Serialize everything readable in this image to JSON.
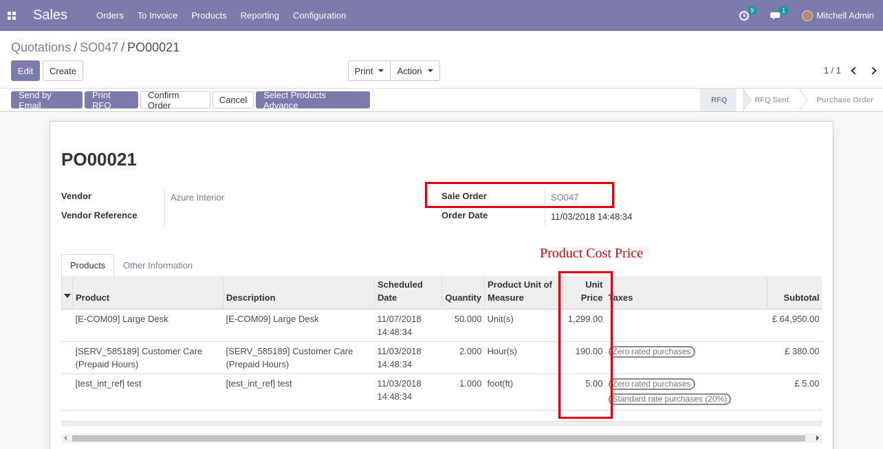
{
  "nav": {
    "brand": "Sales",
    "menu": [
      "Orders",
      "To Invoice",
      "Products",
      "Reporting",
      "Configuration"
    ],
    "activity_badge": "9",
    "messages_badge": "1",
    "user_name": "Mitchell Admin",
    "accent_color": "#7c7bad"
  },
  "breadcrumb": {
    "item1": "Quotations",
    "item2": "SO047",
    "current": "PO00021",
    "sep": "/"
  },
  "controls": {
    "edit": "Edit",
    "create": "Create",
    "print": "Print",
    "action": "Action",
    "pager": "1 / 1"
  },
  "actions": {
    "send_email": "Send by Email",
    "print_rfq": "Print RFQ",
    "confirm": "Confirm Order",
    "cancel": "Cancel",
    "select_products": "Select Products Advance"
  },
  "statusbar": {
    "stages": [
      "RFQ",
      "RFQ Sent",
      "Purchase Order"
    ],
    "active": "RFQ"
  },
  "form": {
    "title": "PO00021",
    "vendor_label": "Vendor",
    "vendor_value": "Azure Interior",
    "vendor_ref_label": "Vendor Reference",
    "sale_order_label": "Sale Order",
    "sale_order_value": "SO047",
    "order_date_label": "Order Date",
    "order_date_value": "11/03/2018 14:48:34"
  },
  "annotation": {
    "text": "Product Cost Price",
    "color": "#e0000f"
  },
  "tabs": [
    "Products",
    "Other Information"
  ],
  "table": {
    "headers": {
      "product": "Product",
      "description": "Description",
      "scheduled_date": "Scheduled Date",
      "quantity": "Quantity",
      "uom": "Product Unit of Measure",
      "unit_price": "Unit Price",
      "taxes": "Taxes",
      "subtotal": "Subtotal"
    },
    "rows": [
      {
        "product": "[E-COM09] Large Desk",
        "description": "[E-COM09] Large Desk",
        "scheduled_date": "11/07/2018 14:48:34",
        "quantity": "50.000",
        "uom": "Unit(s)",
        "unit_price": "1,299.00",
        "taxes": [],
        "subtotal": "£ 64,950.00"
      },
      {
        "product": "[SERV_585189] Customer Care (Prepaid Hours)",
        "description": "[SERV_585189] Customer Care (Prepaid Hours)",
        "scheduled_date": "11/03/2018 14:48:34",
        "quantity": "2.000",
        "uom": "Hour(s)",
        "unit_price": "190.00",
        "taxes": [
          "Zero rated purchases"
        ],
        "subtotal": "£ 380.00"
      },
      {
        "product": "[test_int_ref] test",
        "description": "[test_int_ref] test",
        "scheduled_date": "11/03/2018 14:48:34",
        "quantity": "1.000",
        "uom": "foot(ft)",
        "unit_price": "5.00",
        "taxes": [
          "Zero rated purchases",
          "Standard rate purchases (20%)"
        ],
        "subtotal": "£ 5.00"
      }
    ]
  }
}
